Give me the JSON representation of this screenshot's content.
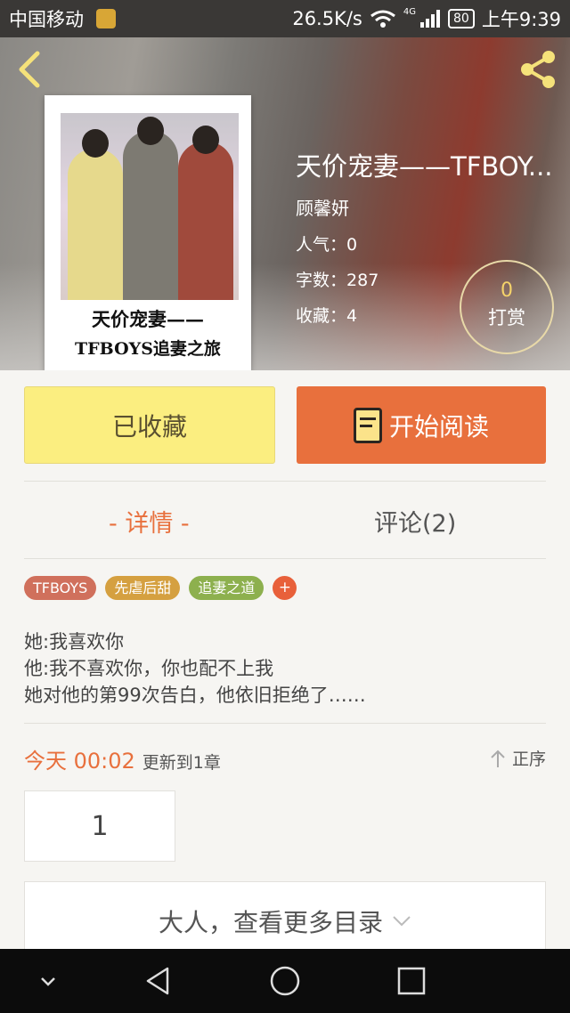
{
  "status_bar": {
    "carrier": "中国移动",
    "speed": "26.5K/s",
    "network_type": "4G",
    "battery": "80",
    "time": "上午9:39"
  },
  "book": {
    "title": "天价宠妻——TFBOY...",
    "author": "顾馨妍",
    "popularity_label": "人气：",
    "popularity": "0",
    "word_count_label": "字数：",
    "word_count": "287",
    "favorites_label": "收藏：",
    "favorites": "4",
    "cover": {
      "title_line1": "天价宠妻——",
      "title_line2": "TFBOYS追妻之旅"
    }
  },
  "reward": {
    "count": "0",
    "label": "打赏"
  },
  "actions": {
    "favorited_label": "已收藏",
    "read_label": "开始阅读"
  },
  "tabs": [
    {
      "label": "- 详情 -"
    },
    {
      "label": "评论(2)"
    }
  ],
  "tags": [
    "TFBOYS",
    "先虐后甜",
    "追妻之道"
  ],
  "tag_add": "+",
  "description": [
    "她:我喜欢你",
    "他:我不喜欢你，你也配不上我",
    "她对他的第99次告白，他依旧拒绝了……"
  ],
  "update": {
    "time": "今天 00:02",
    "text": "更新到1章",
    "sort_label": "正序"
  },
  "chapters": [
    "1"
  ],
  "more_catalog": "大人，查看更多目录",
  "colors": {
    "accent": "#e8703d",
    "favorite_button": "#fbee80",
    "tag_1": "#d0705c",
    "tag_2": "#d5a040",
    "tag_3": "#8db04e"
  },
  "icons": [
    "back-arrow-icon",
    "share-icon",
    "book-icon",
    "sort-arrow-icon",
    "chevron-down-icon",
    "nav-back-icon",
    "nav-home-icon",
    "nav-recent-icon",
    "nav-collapse-icon"
  ]
}
